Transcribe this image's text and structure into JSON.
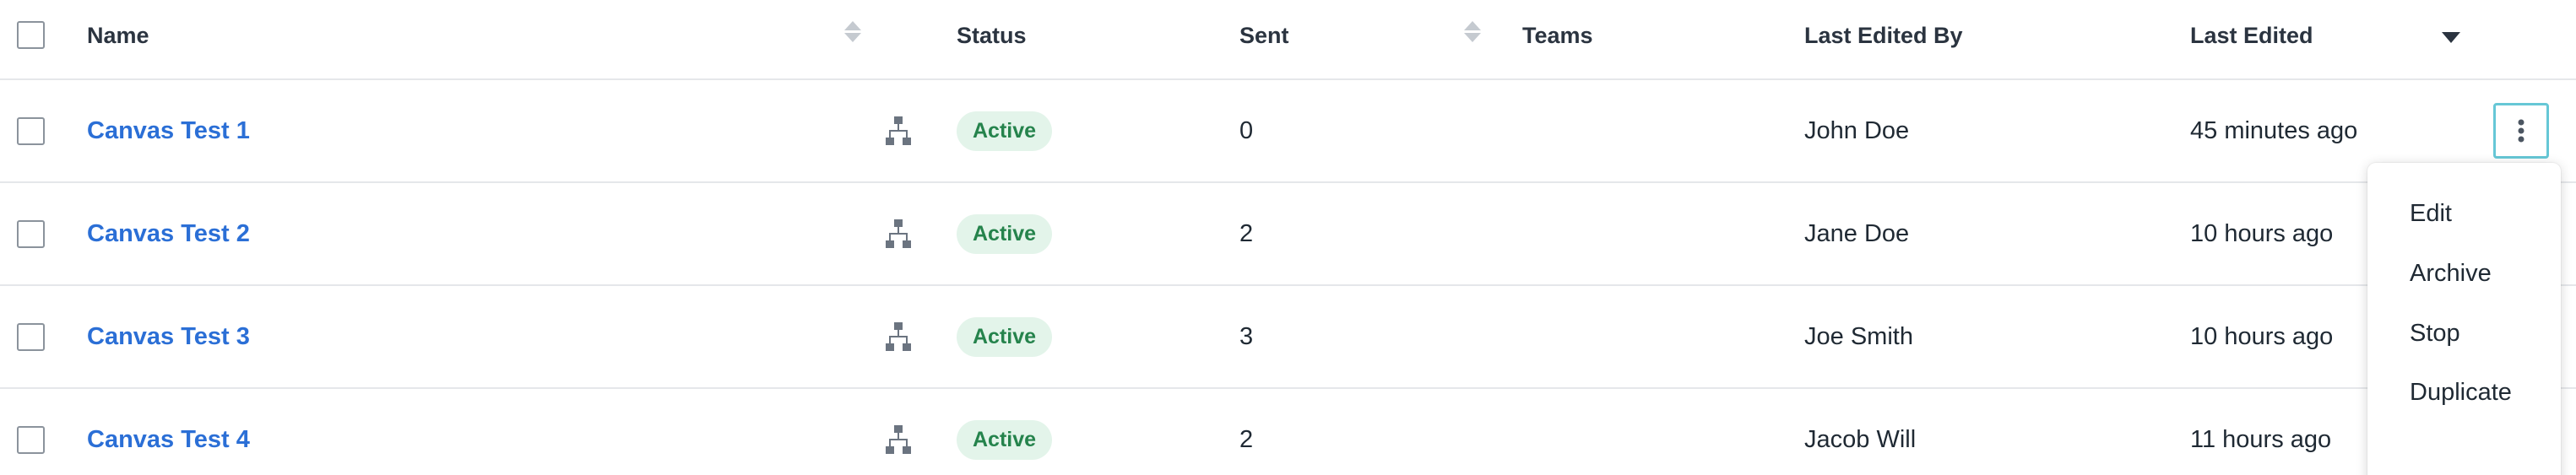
{
  "header": {
    "name": "Name",
    "status": "Status",
    "sent": "Sent",
    "teams": "Teams",
    "last_edited_by": "Last Edited By",
    "last_edited": "Last Edited"
  },
  "rows": [
    {
      "name": "Canvas Test 1",
      "status": "Active",
      "sent": "0",
      "teams": "",
      "last_edited_by": "John Doe",
      "last_edited": "45 minutes ago"
    },
    {
      "name": "Canvas Test 2",
      "status": "Active",
      "sent": "2",
      "teams": "",
      "last_edited_by": "Jane Doe",
      "last_edited": "10 hours ago"
    },
    {
      "name": "Canvas Test 3",
      "status": "Active",
      "sent": "3",
      "teams": "",
      "last_edited_by": "Joe Smith",
      "last_edited": "10 hours ago"
    },
    {
      "name": "Canvas Test 4",
      "status": "Active",
      "sent": "2",
      "teams": "",
      "last_edited_by": "Jacob Will",
      "last_edited": "11 hours ago"
    }
  ],
  "menu": {
    "items": [
      "Edit",
      "Archive",
      "Stop",
      "Duplicate"
    ]
  },
  "icons": {
    "row_type": "hierarchy-icon",
    "actions": "kebab-menu-icon",
    "sort": "sort-icon",
    "sort_active": "caret-down-icon"
  },
  "colors": {
    "link": "#2b6fd6",
    "badge_bg": "#e3f4ea",
    "badge_text": "#25834c",
    "focus_outline": "#66c7d6"
  }
}
